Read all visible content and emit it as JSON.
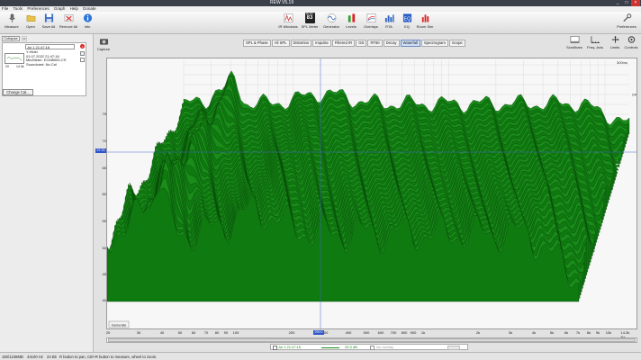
{
  "window": {
    "title": "REW V5.19"
  },
  "menu": [
    "File",
    "Tools",
    "Preferences",
    "Graph",
    "Help",
    "Donate"
  ],
  "toolbar_left": [
    {
      "label": "Measure",
      "icon": "microphone-icon"
    },
    {
      "label": "Open",
      "icon": "folder-icon"
    },
    {
      "label": "Save All",
      "icon": "save-icon"
    },
    {
      "label": "Remove All",
      "icon": "remove-all-icon"
    },
    {
      "label": "Info",
      "icon": "info-icon"
    }
  ],
  "toolbar_center": [
    {
      "label": "IR Windows",
      "icon": "ir-windows-icon"
    },
    {
      "label": "SPL Meter",
      "icon": "spl-meter-icon",
      "readout_top": "dB SPL",
      "readout": "83"
    },
    {
      "label": "Generator",
      "icon": "generator-icon"
    },
    {
      "label": "Levels",
      "icon": "levels-icon"
    },
    {
      "label": "Overlays",
      "icon": "overlays-icon"
    },
    {
      "label": "RTA",
      "icon": "rta-icon"
    },
    {
      "label": "EQ",
      "icon": "eq-icon"
    },
    {
      "label": "Room Sim",
      "icon": "room-sim-icon"
    }
  ],
  "toolbar_right": {
    "label": "Preferences",
    "icon": "preferences-icon"
  },
  "left_panel": {
    "collapse_label": "Collapse",
    "measurement_title": "Jul 1 21:47:16",
    "lines": [
      "Y-Hidel",
      "01.07.2022 21:47:16",
      "Mic/Meter: ECM8000-CS",
      "Soundcard: No Cal"
    ],
    "thumb_labels": [
      "20",
      "14.3k"
    ],
    "change_cal_label": "Change Cal..."
  },
  "graph_tabs": [
    {
      "label": "SPL & Phase",
      "active": false
    },
    {
      "label": "All SPL",
      "active": false
    },
    {
      "label": "Distortion",
      "active": false
    },
    {
      "label": "Impulse",
      "active": false
    },
    {
      "label": "Filtered IR",
      "active": false
    },
    {
      "label": "GD",
      "active": false
    },
    {
      "label": "RT60",
      "active": false
    },
    {
      "label": "Decay",
      "active": false
    },
    {
      "label": "Waterfall",
      "active": true
    },
    {
      "label": "Spectrogram",
      "active": false
    },
    {
      "label": "Scope",
      "active": false
    }
  ],
  "capture_label": "Capture",
  "right_buttons": [
    {
      "label": "Scrollbars",
      "icon": "scrollbars-icon"
    },
    {
      "label": "Freq. Axis",
      "icon": "freq-axis-icon"
    },
    {
      "label": "Limits",
      "icon": "limits-icon"
    },
    {
      "label": "Controls",
      "icon": "controls-icon"
    }
  ],
  "generate_label": "Generate",
  "cursor_readout": "97.93",
  "x_cursor_readout": "290.0",
  "chart_data": {
    "type": "waterfall",
    "x_axis": {
      "scale": "log",
      "range": [
        20,
        14300
      ],
      "ticks": [
        "20",
        "30",
        "40",
        "50",
        "60",
        "70",
        "80",
        "90",
        "100",
        "200",
        "300",
        "400",
        "500",
        "600",
        "700",
        "800",
        "900",
        "1k",
        "2k",
        "3k",
        "4k",
        "5k",
        "6k",
        "7k",
        "8k",
        "9k",
        "10k",
        "14.3k Hz"
      ]
    },
    "y_axis": {
      "range": [
        35,
        105
      ],
      "ticks": [
        "40",
        "45",
        "50",
        "55",
        "60",
        "65",
        "70",
        "75"
      ]
    },
    "z_axis": {
      "label": "300ms",
      "ticks": [
        "0",
        "40",
        "80",
        "120",
        "160",
        "200",
        "240",
        "300"
      ]
    },
    "series_color": "#1a8c1a",
    "fill_color": "#0f7a10",
    "background": "#f7f7f7",
    "grid": true
  },
  "legend": {
    "name": "Jul 1 21:47:16",
    "value": "25.3 dB",
    "overlay": "No overlay"
  },
  "statusbar": {
    "memory": "150/1248MB",
    "samplerate": "44100 Hz",
    "bits": "24 Bit",
    "hint": "R button to pan, Ctrl+R button to measure, wheel to zoom."
  }
}
